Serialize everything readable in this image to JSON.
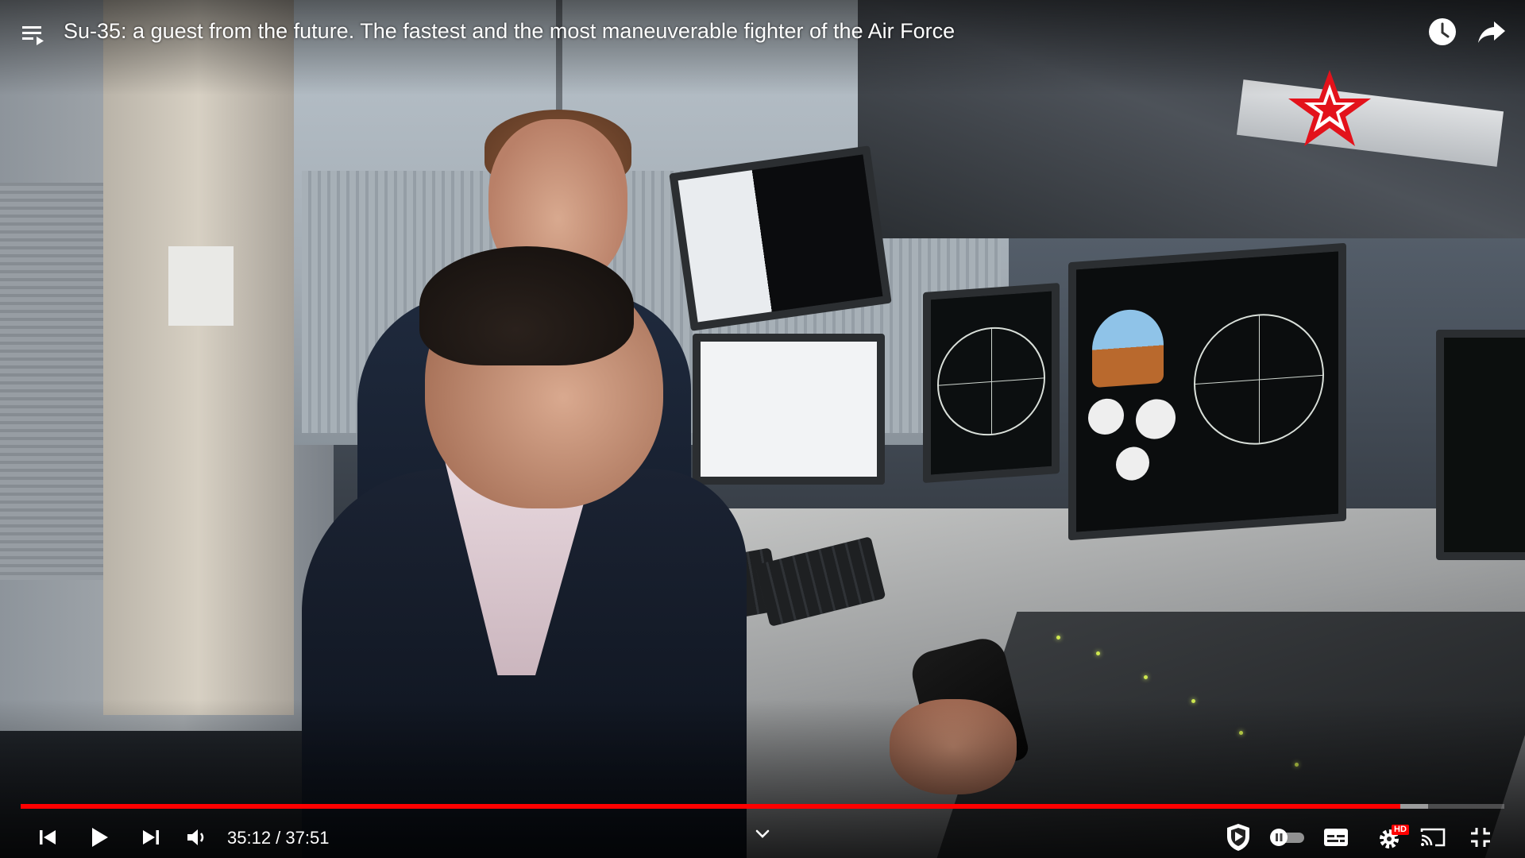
{
  "player": {
    "title": "Su-35: a guest from the future. The fastest and the most maneuverable fighter of the Air Force",
    "current_time": "35:12",
    "separator": " / ",
    "duration": "37:51",
    "progress_fraction": 0.9299,
    "buffer_fraction": 0.9484,
    "quality_badge": "HD",
    "accent_color": "#ff0000"
  },
  "icons": {
    "playlist": "playlist-icon",
    "watch_later": "clock-icon",
    "share": "share-icon",
    "previous": "previous-icon",
    "play": "play-icon",
    "next": "next-icon",
    "volume": "volume-icon",
    "chevron": "chevron-down-icon",
    "shield": "shield-icon",
    "autoplay": "autoplay-toggle-icon",
    "captions": "captions-icon",
    "settings": "gear-icon",
    "cast": "cast-icon",
    "exit_fullscreen": "exit-fullscreen-icon"
  }
}
